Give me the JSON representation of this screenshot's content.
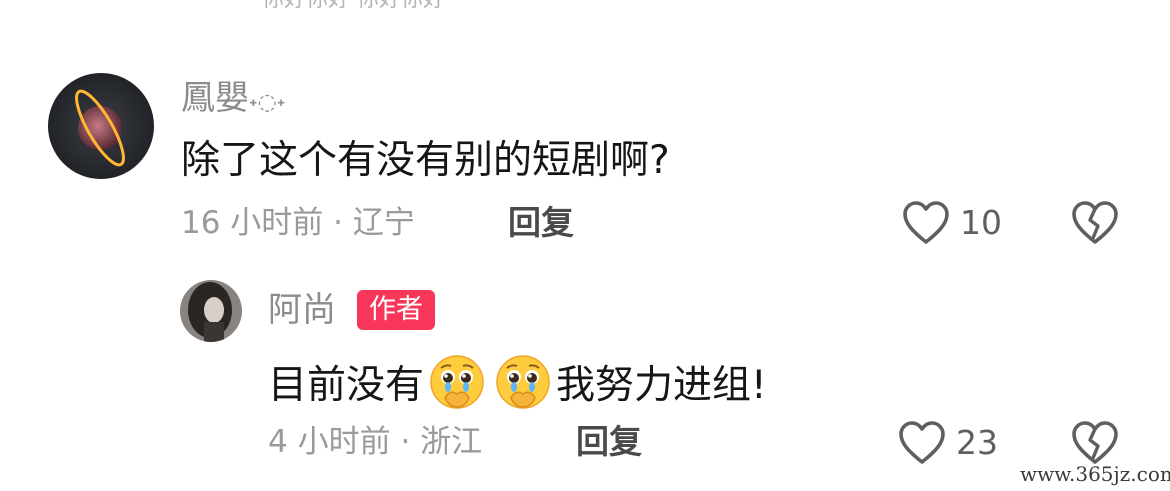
{
  "top_fragment": "你好你好  你好你好",
  "comment": {
    "username": "鳳嬰",
    "username_suffix": "˖◌˖",
    "text": "除了这个有没有别的短剧啊?",
    "time": "16 小时前",
    "location": "辽宁",
    "separator": "·",
    "reply_label": "回复",
    "like_count": "10"
  },
  "reply": {
    "username": "阿尚",
    "badge": "作者",
    "text_before": "目前没有",
    "emoji_name": "pleading-face-hands",
    "text_after": "我努力进组!",
    "time": "4 小时前",
    "location": "浙江",
    "separator": "·",
    "reply_label": "回复",
    "like_count": "23"
  },
  "watermark": "www.365jz.com",
  "colors": {
    "badge": "#f7365a",
    "meta": "#9a9a9a",
    "username": "#8c8c8c",
    "content": "#161616"
  }
}
